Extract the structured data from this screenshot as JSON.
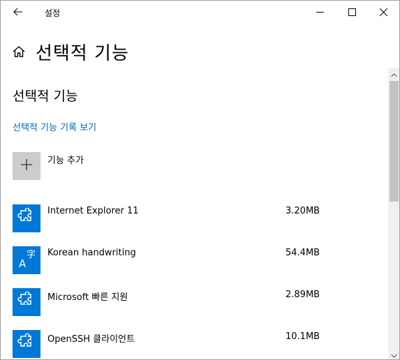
{
  "window": {
    "title": "설정",
    "icons": {
      "back": "arrow-left-icon",
      "minimize": "minimize-icon",
      "maximize": "maximize-icon",
      "close": "close-icon"
    }
  },
  "page": {
    "title": "선택적 기능",
    "home_icon": "home-icon"
  },
  "section": {
    "title": "선택적 기능",
    "history_link": "선택적 기능 기록 보기"
  },
  "add_feature": {
    "label": "기능 추가",
    "icon": "plus-icon"
  },
  "features": [
    {
      "name": "Internet Explorer 11",
      "size": "3.20MB",
      "icon": "puzzle-icon"
    },
    {
      "name": "Korean handwriting",
      "size": "54.4MB",
      "icon": "language-icon"
    },
    {
      "name": "Microsoft 빠른 지원",
      "size": "2.89MB",
      "icon": "puzzle-icon"
    },
    {
      "name": "OpenSSH 클라이언트",
      "size": "10.1MB",
      "icon": "puzzle-icon"
    }
  ],
  "colors": {
    "accent": "#0078d7",
    "link": "#0067c0",
    "add_tile": "#cccccc"
  }
}
